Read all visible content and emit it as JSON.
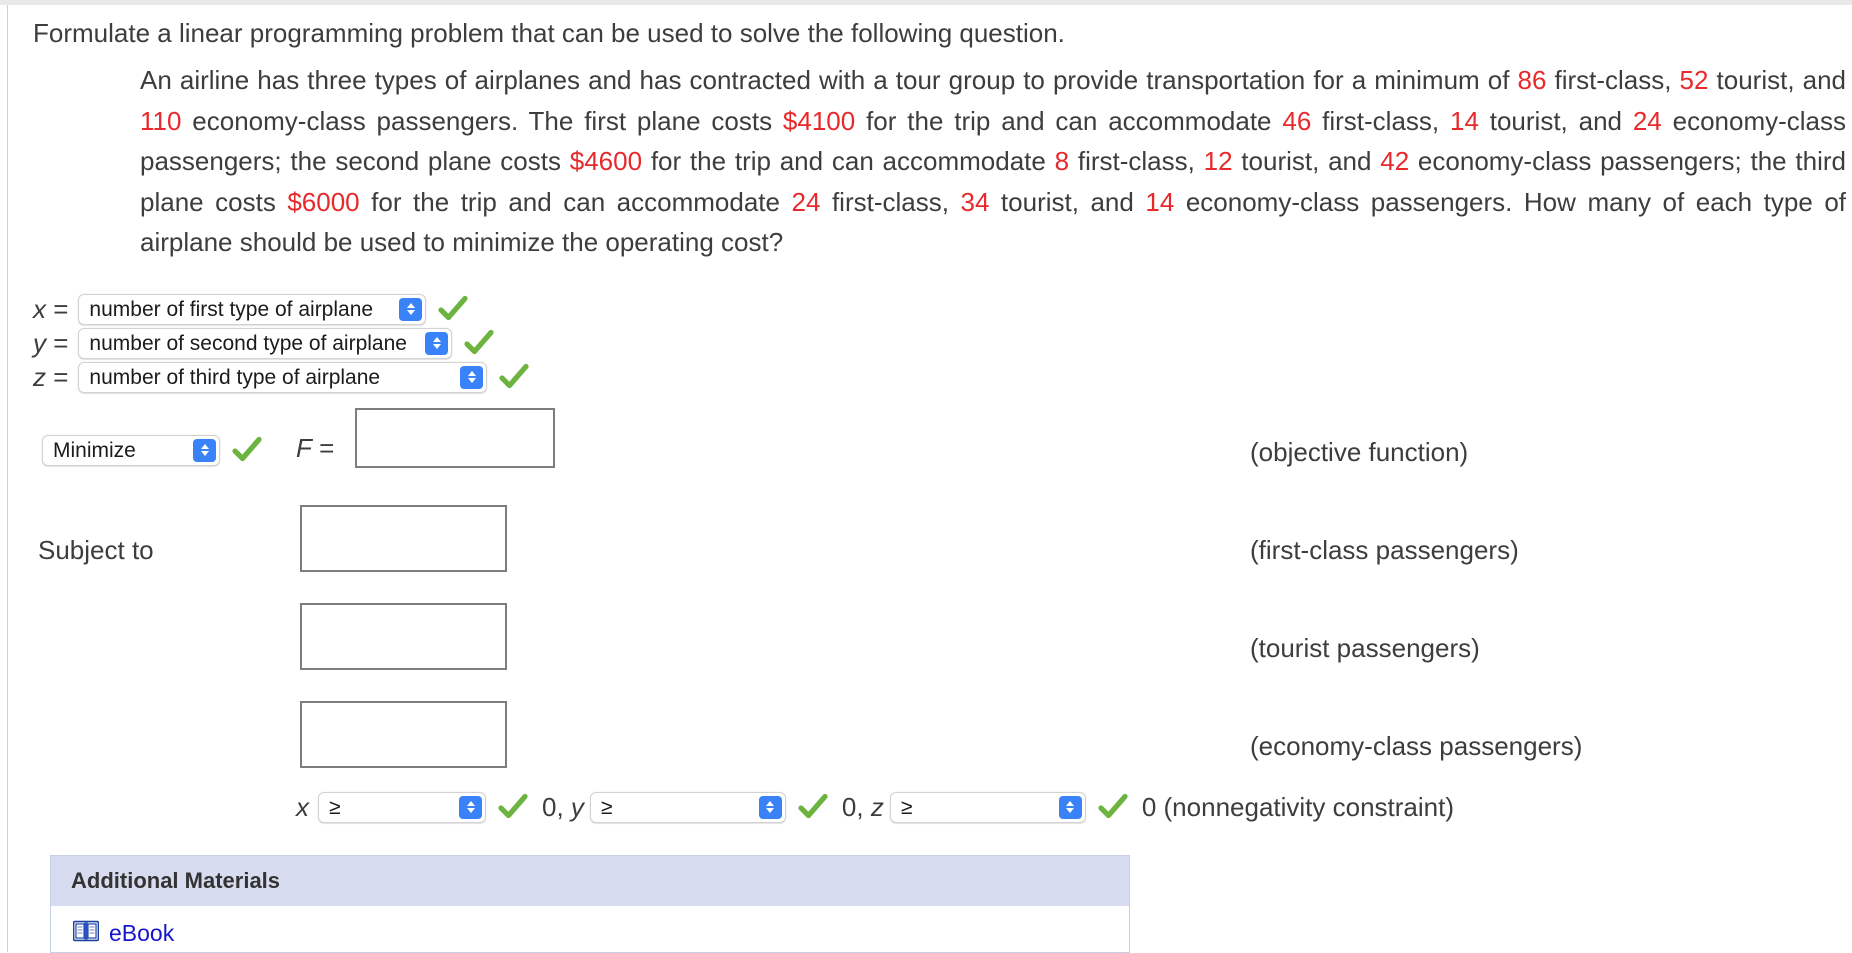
{
  "colors": {
    "highlight_number": "#e8292c",
    "accent_blue": "#3a82f7",
    "check_green": "#6cb33f",
    "panel_header": "#d7dcf0",
    "link_blue": "#1515cd"
  },
  "prompt": "Formulate a linear programming problem that can be used to solve the following question.",
  "problem": {
    "segments": [
      {
        "t": "An airline has three types of airplanes and has contracted with a tour group to provide transportation for a minimum of ",
        "n": false
      },
      {
        "t": "86",
        "n": true
      },
      {
        "t": " first-class, ",
        "n": false
      },
      {
        "t": "52",
        "n": true
      },
      {
        "t": " tourist, and ",
        "n": false
      },
      {
        "t": "110",
        "n": true
      },
      {
        "t": " economy-class passengers. The first plane costs ",
        "n": false
      },
      {
        "t": "$4100",
        "n": true
      },
      {
        "t": " for the trip and can accommodate ",
        "n": false
      },
      {
        "t": "46",
        "n": true
      },
      {
        "t": " first-class, ",
        "n": false
      },
      {
        "t": "14",
        "n": true
      },
      {
        "t": " tourist, and ",
        "n": false
      },
      {
        "t": "24",
        "n": true
      },
      {
        "t": " economy-class passengers; the second plane costs ",
        "n": false
      },
      {
        "t": "$4600",
        "n": true
      },
      {
        "t": " for the trip and can accommodate ",
        "n": false
      },
      {
        "t": "8",
        "n": true
      },
      {
        "t": " first-class, ",
        "n": false
      },
      {
        "t": "12",
        "n": true
      },
      {
        "t": " tourist, and ",
        "n": false
      },
      {
        "t": "42",
        "n": true
      },
      {
        "t": " economy-class passengers; the third plane costs ",
        "n": false
      },
      {
        "t": "$6000",
        "n": true
      },
      {
        "t": " for the trip and can accommodate ",
        "n": false
      },
      {
        "t": "24",
        "n": true
      },
      {
        "t": " first-class, ",
        "n": false
      },
      {
        "t": "34",
        "n": true
      },
      {
        "t": " tourist, and ",
        "n": false
      },
      {
        "t": "14",
        "n": true
      },
      {
        "t": " economy-class passengers. How many of each type of airplane should be used to minimize the operating cost?",
        "n": false
      }
    ]
  },
  "variables": [
    {
      "symbol": "x",
      "equals": "=",
      "value": "number of first type of airplane",
      "status": "correct"
    },
    {
      "symbol": "y",
      "equals": "=",
      "value": "number of second type of airplane",
      "status": "correct"
    },
    {
      "symbol": "z",
      "equals": "=",
      "value": "number of third type of airplane",
      "status": "correct"
    }
  ],
  "objective": {
    "direction_value": "Minimize",
    "direction_status": "correct",
    "f_label": "F",
    "f_equals": "=",
    "input_value": "",
    "right_label": "(objective function)"
  },
  "subject_to_label": "Subject to",
  "constraints": [
    {
      "input_value": "",
      "right_label": "(first-class passengers)"
    },
    {
      "input_value": "",
      "right_label": "(tourist passengers)"
    },
    {
      "input_value": "",
      "right_label": "(economy-class passengers)"
    }
  ],
  "nonnegativity": {
    "items": [
      {
        "var": "x",
        "op": "≥",
        "status": "correct",
        "tail": "0, y"
      },
      {
        "var": "",
        "op": "≥",
        "status": "correct",
        "tail": "0, z"
      },
      {
        "var": "",
        "op": "≥",
        "status": "correct",
        "tail": ""
      }
    ],
    "x_var": "x",
    "op1": "≥",
    "mid1": "0,",
    "y_var": "y",
    "op2": "≥",
    "mid2": "0,",
    "z_var": "z",
    "op3": "≥",
    "final": "0 (nonnegativity constraint)"
  },
  "additional_materials": {
    "title": "Additional Materials",
    "items": [
      {
        "label": "eBook",
        "icon": "book-icon"
      }
    ]
  }
}
